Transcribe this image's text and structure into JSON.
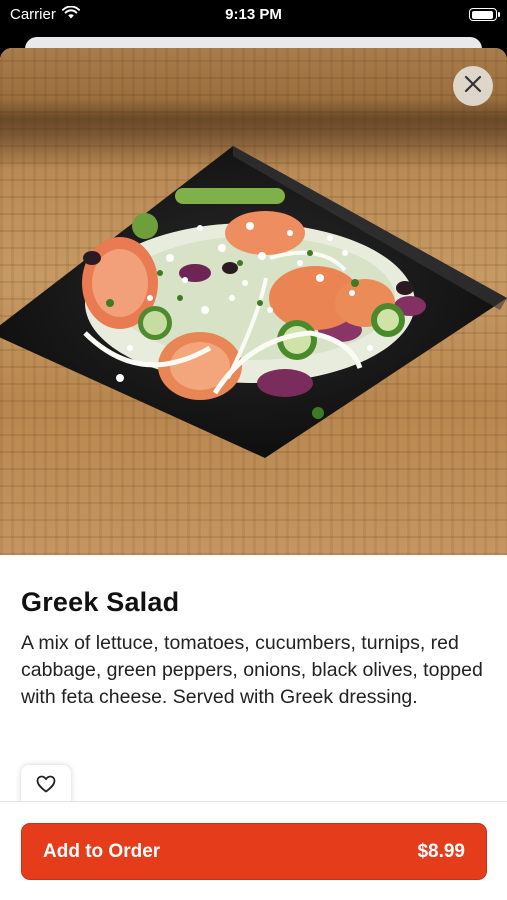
{
  "status_bar": {
    "carrier": "Carrier",
    "time": "9:13 PM"
  },
  "icons": {
    "wifi": "wifi-icon",
    "battery": "battery-icon",
    "close": "close-icon",
    "favorite": "heart-icon"
  },
  "item": {
    "name": "Greek Salad",
    "description": "A mix of lettuce, tomatoes, cucumbers, turnips, red cabbage, green peppers, onions, black olives, topped with feta cheese. Served with Greek dressing."
  },
  "order": {
    "add_label": "Add to Order",
    "price": "$8.99"
  },
  "colors": {
    "accent": "#e53c1c",
    "text": "#111111"
  }
}
